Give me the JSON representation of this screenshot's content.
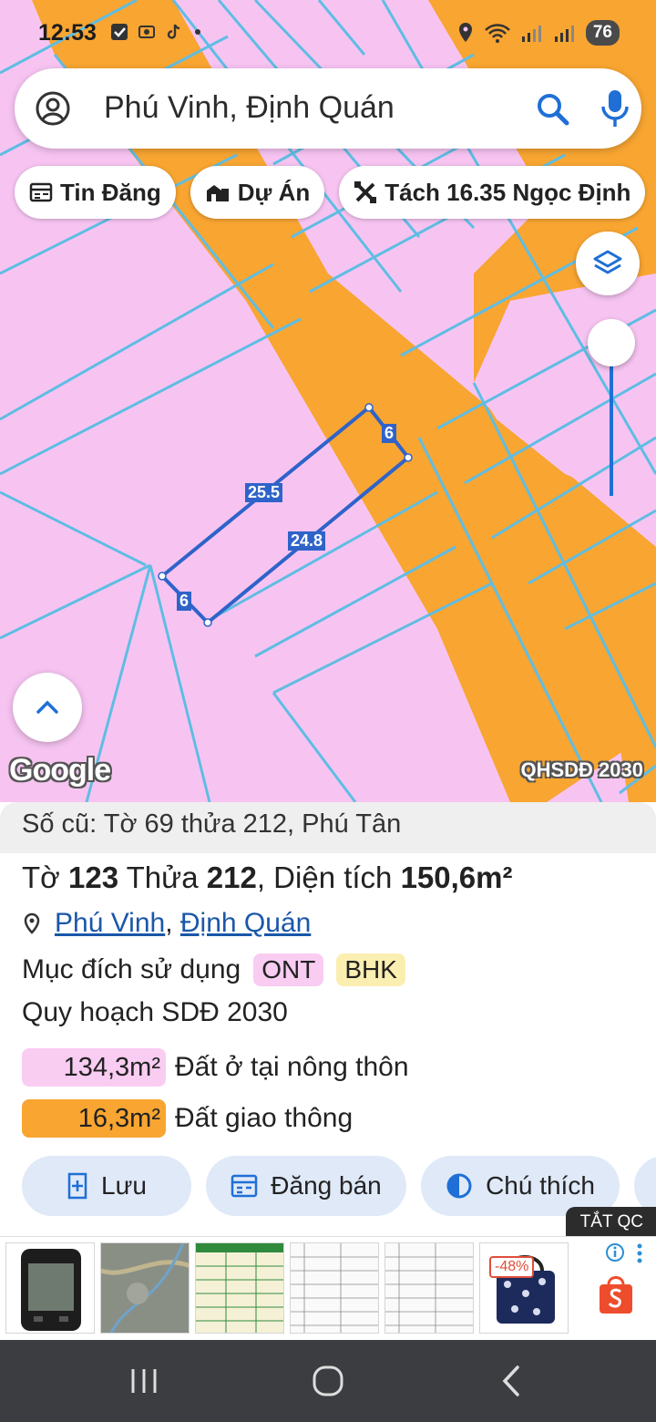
{
  "status_bar": {
    "time": "12:53",
    "battery": "76"
  },
  "search": {
    "query": "Phú Vinh, Định Quán"
  },
  "chips": [
    {
      "label": "Tin Đăng",
      "icon": "news-icon"
    },
    {
      "label": "Dự Án",
      "icon": "building-icon"
    },
    {
      "label": "Tách 16.35 Ngọc Định",
      "icon": "tools-icon"
    }
  ],
  "parcel_dimensions": {
    "top": "25.5",
    "bottom": "24.8",
    "right": "6",
    "left": "6"
  },
  "map_labels": {
    "google": "Google",
    "plan_tag": "QHSDĐ 2030"
  },
  "info": {
    "old_number": "Số cũ: Tờ 69 thửa 212, Phú Tân",
    "sheet_label": "Tờ",
    "sheet_number": "123",
    "parcel_label": "Thửa",
    "parcel_number": "212",
    "area_label": "Diện tích",
    "area_value": "150,6m²",
    "commune": "Phú Vinh",
    "district": "Định Quán",
    "usage_label": "Mục đích sử dụng",
    "usage_tags": [
      "ONT",
      "BHK"
    ],
    "plan_title": "Quy hoạch SDĐ 2030",
    "plan_items": [
      {
        "area": "134,3m²",
        "label": "Đất ở tại nông thôn",
        "color": "#f9ccf2"
      },
      {
        "area": "16,3m²",
        "label": "Đất giao thông",
        "color": "#f8a531"
      }
    ]
  },
  "actions": [
    {
      "label": "Lưu",
      "icon": "bookmark-add-icon"
    },
    {
      "label": "Đăng bán",
      "icon": "listing-icon"
    },
    {
      "label": "Chú thích",
      "icon": "contrast-icon"
    }
  ],
  "ad": {
    "label": "TẮT QC",
    "discount": "-48%"
  },
  "colors": {
    "land_pink": "#f7c4f2",
    "road_orange": "#f8a531",
    "boundary_blue": "#5fbde3",
    "selection_blue": "#2f63c9"
  }
}
